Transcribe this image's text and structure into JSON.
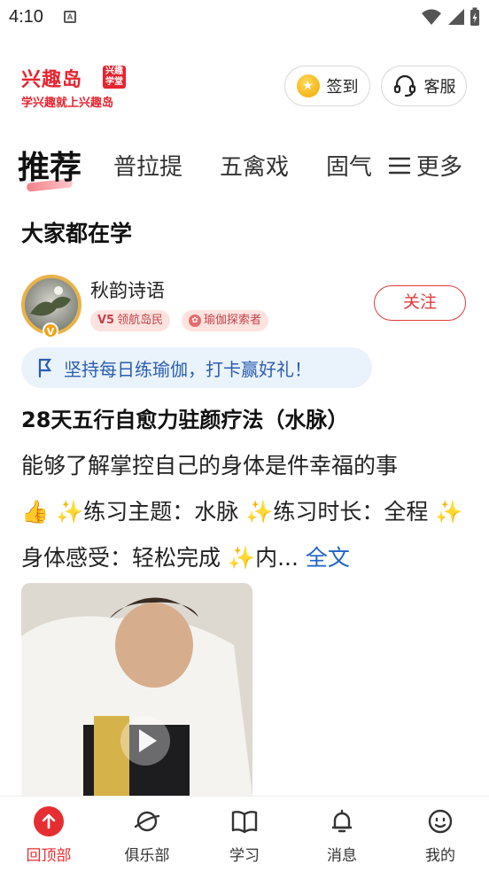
{
  "status_bar": {
    "time": "4:10",
    "notification_letter": "A"
  },
  "header": {
    "logo_main": "兴趣岛",
    "logo_badge": "兴趣学堂",
    "logo_slogan": "学兴趣就上兴趣岛",
    "checkin_label": "签到",
    "service_label": "客服"
  },
  "tabs": [
    {
      "label": "推荐",
      "active": true
    },
    {
      "label": "普拉提",
      "active": false
    },
    {
      "label": "五禽戏",
      "active": false
    },
    {
      "label": "固气",
      "active": false
    }
  ],
  "more_label": "更多",
  "section_title": "大家都在学",
  "post": {
    "author": "秋韵诗语",
    "level_badge_level": "V5",
    "level_badge_text": "领航岛民",
    "role_badge": "瑜伽探索者",
    "avatar_badge": "V",
    "follow_label": "关注",
    "tip": "坚持每日练瑜伽，打卡赢好礼！",
    "title": "28天五行自愈力驻颜疗法（水脉）",
    "body_intro": " 能够了解掌控自己的身体是件幸福的事",
    "body_theme": "练习主题：水脉 ",
    "body_duration": "练习时长：全程 ",
    "body_feeling": "身体感受：轻松完成 ",
    "body_tail": "内...",
    "more_label": "全文"
  },
  "bottom_nav": [
    {
      "label": "回顶部",
      "icon": "arrow-up-icon",
      "active": true
    },
    {
      "label": "俱乐部",
      "icon": "planet-icon",
      "active": false
    },
    {
      "label": "学习",
      "icon": "book-icon",
      "active": false
    },
    {
      "label": "消息",
      "icon": "bell-icon",
      "active": false
    },
    {
      "label": "我的",
      "icon": "smiley-icon",
      "active": false
    }
  ],
  "colors": {
    "brand_red": "#e7242f",
    "link_blue": "#1f62c8",
    "tip_bg": "#eaf2fc"
  }
}
